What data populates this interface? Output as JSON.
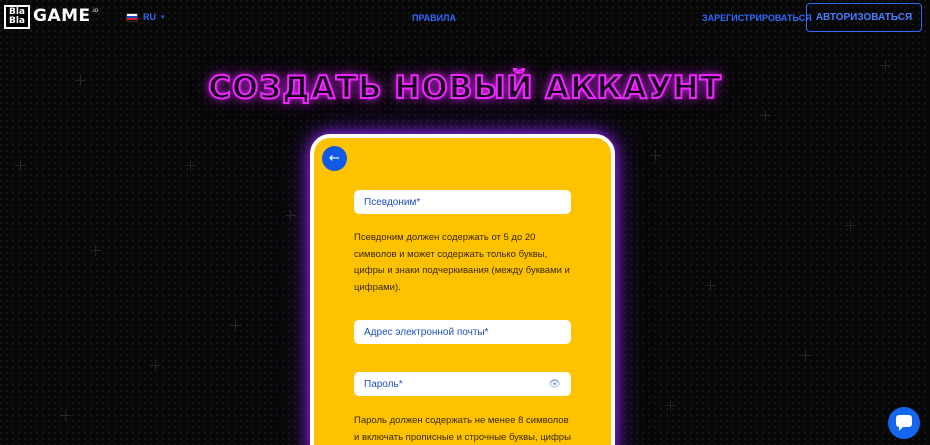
{
  "header": {
    "logo_box_line1": "Bla",
    "logo_box_line2": "Bla",
    "logo_text": "GAME",
    "logo_suffix": ".io",
    "language": "RU",
    "rules_label": "ПРАВИЛА",
    "register_label": "ЗАРЕГИСТРИРОВАТЬСЯ",
    "login_label": "АВТОРИЗОВАТЬСЯ"
  },
  "page": {
    "title": "СОЗДАТЬ НОВЫЙ АККАУНТ"
  },
  "form": {
    "back_icon": "←",
    "nickname_placeholder": "Псевдоним*",
    "nickname_hint": "Псевдоним должен содержать от 5 до 20 символов и может содержать только буквы, цифры и знаки подчеркивания (между буквами и цифрами).",
    "email_placeholder": "Адрес электронной почты*",
    "password_placeholder": "Пароль*",
    "eye_icon": "👁",
    "password_hint": "Пароль должен содержать не менее 8 символов и включать прописные и строчные буквы, цифры"
  },
  "colors": {
    "accent_blue": "#2f6bff",
    "card_yellow": "#ffc200",
    "title_magenta": "#ee27ff",
    "flag": [
      "#ffffff",
      "#1c47d1",
      "#e0201f"
    ]
  },
  "icons": {
    "back": "arrow-left-icon",
    "eye": "eye-icon",
    "chat": "chat-icon",
    "caret": "chevron-down-icon"
  }
}
